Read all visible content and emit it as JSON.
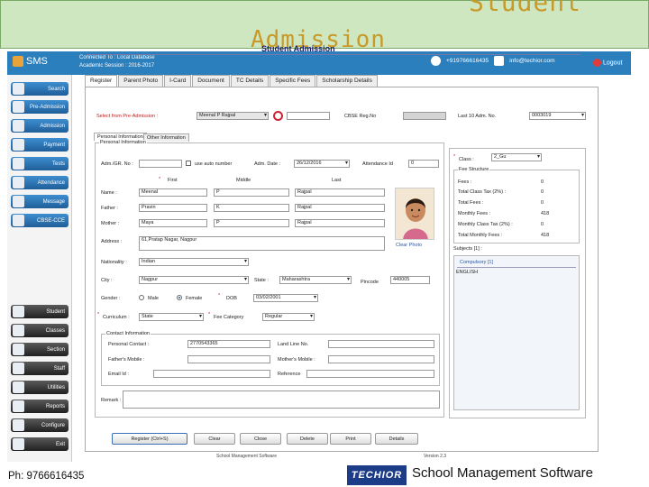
{
  "slide": {
    "title_top": "Student",
    "title_bottom": "Admission",
    "phone": "Ph: 9766616435",
    "brand_logo": "TECHIOR",
    "brand_name": "School Management Software"
  },
  "app": {
    "logo": "SMS",
    "connected": "Connected To : Local Database",
    "session": "Academic Session : 2016-2017",
    "phone": "+919766616435",
    "email": "info@techior.com",
    "logout": "Logout"
  },
  "sidebar": {
    "top_items": [
      "Search",
      "Pre-Admission",
      "Admission",
      "Payment",
      "Tests",
      "Attendance",
      "Message",
      "CBSE-CCE"
    ],
    "bottom_items": [
      "Student",
      "Classes",
      "Section",
      "Staff",
      "Utilities",
      "Reports",
      "Configure",
      "Exit"
    ]
  },
  "tabs": [
    "Register",
    "Parent Photo",
    "I-Card",
    "Document",
    "TC Details",
    "Specific Fees",
    "Scholarship Details"
  ],
  "form": {
    "title": "Student Admission",
    "select_pre_admission_label": "Select from Pre-Admission :",
    "select_pre_admission_value": "Meenal P Rajpal",
    "cbse_reg_label": "CBSE Reg.No",
    "last10_label": "Last 10 Adm. No.",
    "last10_value": "0003019",
    "subtabs": [
      "Personal Information",
      "Other Information"
    ],
    "personal_info_title": "Personal Information",
    "adm_gr_label": "Adm./GR. No :",
    "auto_number_label": "use auto number",
    "adm_date_label": "Adm. Date :",
    "adm_date_value": "26/12/2016",
    "attendance_id_label": "Attendance Id",
    "attendance_id_value": "0",
    "col_first": "First",
    "col_middle": "Middle",
    "col_last": "Last",
    "name_label": "Name :",
    "name_first": "Meenal",
    "name_middle": "P",
    "name_last": "Rajpal",
    "father_label": "Father :",
    "father_first": "Pravin",
    "father_middle": "K",
    "father_last": "Rajpal",
    "mother_label": "Mother :",
    "mother_first": "Maya",
    "mother_middle": "P",
    "mother_last": "Rajpal",
    "address_label": "Address :",
    "address_value": "61,Pratap Nagar, Nagpur",
    "clear_photo": "Clear Photo",
    "nationality_label": "Nationality :",
    "nationality_value": "Indian",
    "city_label": "City :",
    "city_value": "Nagpur",
    "state_label": "State :",
    "state_value": "Maharashtra",
    "pincode_label": "Pincode",
    "pincode_value": "440005",
    "gender_label": "Gender :",
    "gender_male": "Male",
    "gender_female": "Female",
    "dob_label": "DOB",
    "dob_value": "03/02/2001",
    "curriculum_label": "Curriculum :",
    "curriculum_value": "State",
    "fee_category_label": "Fee Category",
    "fee_category_value": "Regular",
    "contact_title": "Contact Information",
    "personal_contact_label": "Personal Contact :",
    "personal_contact_value": "2770543365",
    "landline_label": "Land Line No.",
    "father_mobile_label": "Father's Mobile :",
    "mother_mobile_label": "Mother's Mobile :",
    "email_label": "Email Id :",
    "reference_label": "Reference",
    "remark_label": "Remark :"
  },
  "class_panel": {
    "class_label": "Class :",
    "class_value": "2_Gu",
    "fee_structure_title": "Fee Structure",
    "fees": [
      {
        "label": "Fees :",
        "value": "0"
      },
      {
        "label": "Total Class Tax (2%) :",
        "value": "0"
      },
      {
        "label": "Total Fees :",
        "value": "0"
      },
      {
        "label": "Monthly Fees :",
        "value": "418"
      },
      {
        "label": "Monthly Class Tax (2%) :",
        "value": "0"
      },
      {
        "label": "Total Monthly Fees :",
        "value": "418"
      }
    ],
    "subjects_label": "Subjects [1] :",
    "compulsory_label": "Compulsory [1]",
    "subject_item": "ENGLISH"
  },
  "buttons": [
    "Register (Ctrl+S)",
    "Clear",
    "Close",
    "Delete",
    "Print",
    "Details"
  ],
  "footer": {
    "software": "School Management Software",
    "version": "Version 2.3"
  },
  "colors": {
    "header_bg": "#cfe7c0",
    "title_gold": "#c79a2a",
    "app_blue": "#2b7fbd",
    "brand_navy": "#1c3c87"
  }
}
